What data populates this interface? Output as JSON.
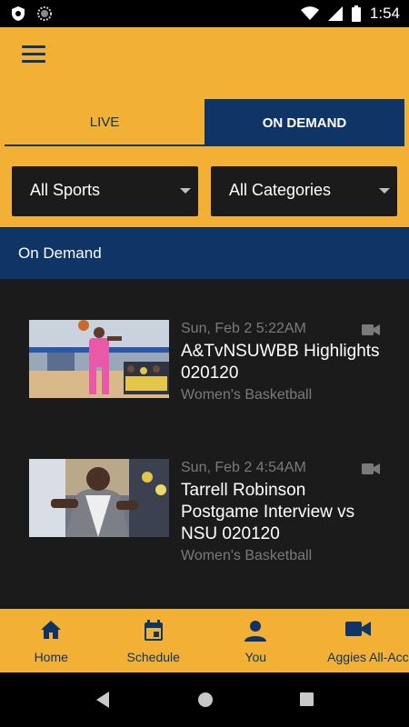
{
  "status_bar": {
    "time": "1:54",
    "icons": [
      "shield-icon",
      "circle-icon",
      "wifi-icon",
      "signal-icon",
      "battery-icon"
    ]
  },
  "app_bar": {
    "menu_icon": "hamburger-menu-icon"
  },
  "tabs": [
    {
      "label": "LIVE",
      "selected": false
    },
    {
      "label": "ON DEMAND",
      "selected": true
    }
  ],
  "filters": {
    "sports": {
      "value": "All Sports"
    },
    "categories": {
      "value": "All Categories"
    }
  },
  "section": {
    "title": "On Demand"
  },
  "videos": [
    {
      "date": "Sun, Feb 2 5:22AM",
      "title": "A&TvNSUWBB Highlights 020120",
      "category": "Women's Basketball",
      "icon": "video-camera-icon"
    },
    {
      "date": "Sun, Feb 2 4:54AM",
      "title": "Tarrell Robinson Postgame Interview vs NSU 020120",
      "category": "Women's Basketball",
      "icon": "video-camera-icon"
    }
  ],
  "bottom_nav": [
    {
      "label": "Home",
      "icon": "home-icon"
    },
    {
      "label": "Schedule",
      "icon": "calendar-icon"
    },
    {
      "label": "You",
      "icon": "person-icon"
    },
    {
      "label": "Aggies All-Acc...",
      "icon": "video-camera-icon"
    }
  ],
  "colors": {
    "gold": "#f2b134",
    "navy": "#0f3466",
    "dark": "#1b1b1b",
    "muted_text": "#7a7a7a"
  }
}
